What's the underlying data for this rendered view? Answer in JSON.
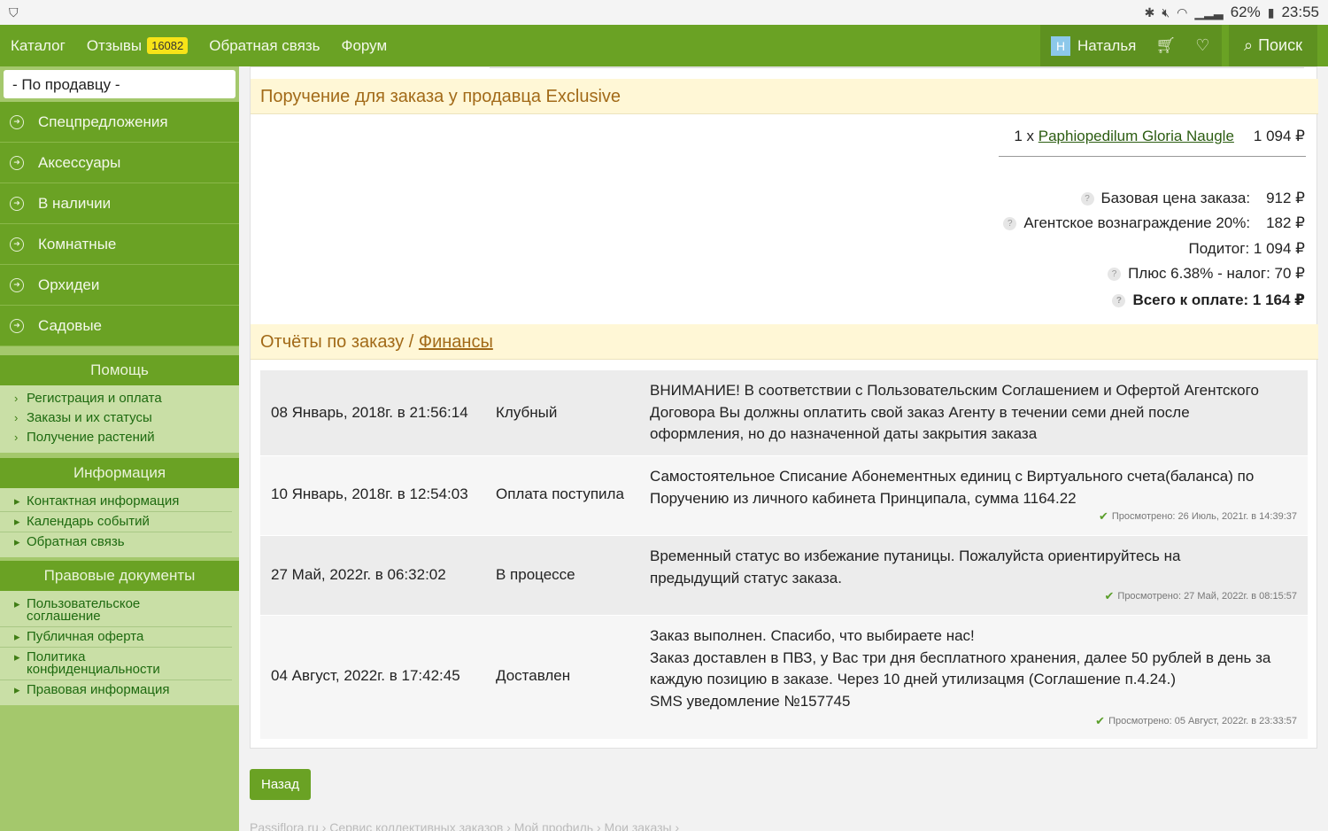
{
  "statusbar": {
    "battery": "62%",
    "time": "23:55",
    "shield": "shield-icon"
  },
  "nav": {
    "catalog": "Каталог",
    "reviews": "Отзывы",
    "reviews_count": "16082",
    "feedback": "Обратная связь",
    "forum": "Форум",
    "user_initial": "Н",
    "user_name": "Наталья",
    "search": "Поиск"
  },
  "sidebar": {
    "seller_select": "- По продавцу -",
    "categories": [
      "Спецпредложения",
      "Аксессуары",
      "В наличии",
      "Комнатные",
      "Орхидеи",
      "Садовые"
    ],
    "help": {
      "title": "Помощь",
      "links": [
        "Регистрация и оплата",
        "Заказы и их статусы",
        "Получение растений"
      ]
    },
    "info": {
      "title": "Информация",
      "links": [
        "Контактная информация",
        "Календарь событий",
        "Обратная связь"
      ]
    },
    "legal": {
      "title": "Правовые документы",
      "links": [
        "Пользовательское соглашение",
        "Публичная оферта",
        "Политика конфиденциальности",
        "Правовая информация"
      ]
    }
  },
  "order": {
    "title": "Поручение для заказа у продавца Exclusive",
    "qty": "1 x",
    "item": "Paphiopedilum Gloria Naugle",
    "item_price": "1 094 ₽",
    "base_label": "Базовая цена заказа:",
    "base_value": "912 ₽",
    "agent_label": "Агентское вознаграждение 20%:",
    "agent_value": "182 ₽",
    "subtotal": "Подитог: 1 094 ₽",
    "tax": "Плюс 6.38% - налог: 70 ₽",
    "total": "Всего к оплате: 1 164 ₽"
  },
  "reports": {
    "title": "Отчёты по заказу / ",
    "finance_link": "Финансы",
    "rows": [
      {
        "date": "08 Январь, 2018г. в 21:56:14",
        "status": "Клубный",
        "message": [
          "ВНИМАНИЕ! В соответствии с Пользовательским Соглашением и Офертой Агентского",
          "Договора Вы должны оплатить свой заказ Агенту в течении семи дней после",
          "оформления, но до назначенной даты закрытия заказа"
        ],
        "viewed": ""
      },
      {
        "date": "10 Январь, 2018г. в 12:54:03",
        "status": "Оплата поступила",
        "message": [
          "Самостоятельное Списание Абонементных единиц с Виртуального счета(баланса) по",
          "Поручению из личного кабинета Принципала, сумма 1164.22"
        ],
        "viewed": "Просмотрено: 26 Июль, 2021г. в 14:39:37"
      },
      {
        "date": "27 Май, 2022г. в 06:32:02",
        "status": "В процессе",
        "message": [
          "Временный статус во избежание путаницы. Пожалуйста ориентируйтесь на",
          "предыдущий статус заказа."
        ],
        "viewed": "Просмотрено: 27 Май, 2022г. в 08:15:57"
      },
      {
        "date": "04 Август, 2022г. в 17:42:45",
        "status": "Доставлен",
        "message": [
          "Заказ выполнен. Спасибо, что выбираете нас!",
          "Заказ доставлен в ПВЗ, у Вас три дня бесплатного хранения, далее 50 рублей в день за",
          "каждую позицию в заказе. Через 10 дней утилизацмя (Соглашение п.4.24.)",
          "SMS уведомление №157745"
        ],
        "viewed": "Просмотрено: 05 Август, 2022г. в 23:33:57"
      }
    ]
  },
  "back_button": "Назад",
  "breadcrumb": "Passiflora.ru › Сервис коллективных заказов › Мой профиль › Мои заказы ›"
}
